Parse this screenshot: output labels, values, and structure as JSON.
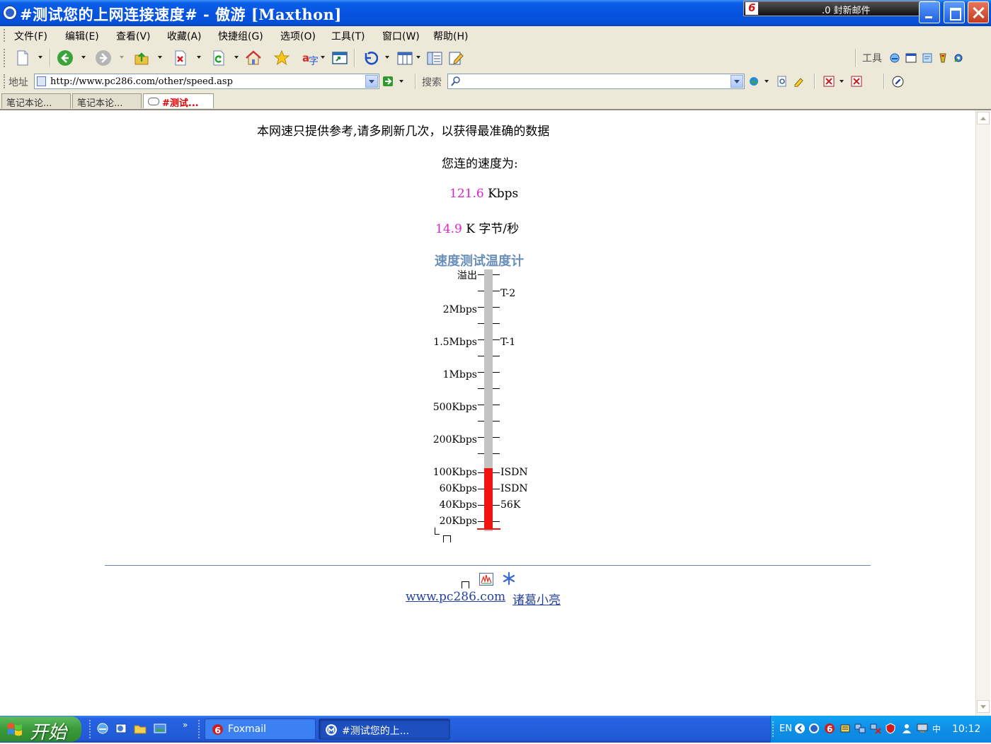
{
  "window": {
    "title": "#测试您的上网连接速度# - 傲游 [Maxthon]",
    "mail_notice": ".0 封新邮件"
  },
  "menu": [
    "文件(F)",
    "编辑(E)",
    "查看(V)",
    "收藏(A)",
    "快捷组(G)",
    "选项(O)",
    "工具(T)",
    "窗口(W)",
    "帮助(H)"
  ],
  "toolbar": {
    "tools_label": "工具"
  },
  "address": {
    "label": "地址",
    "url": "http://www.pc286.com/other/speed.asp",
    "search_label": "搜索",
    "search_value": ""
  },
  "tabs": [
    {
      "label": "笔记本论..."
    },
    {
      "label": "笔记本论..."
    },
    {
      "label": "#测试..."
    }
  ],
  "page": {
    "notice": "本网速只提供参考,请多刷新几次，以获得最准确的数据",
    "speed_label": "您连的速度为:",
    "kbps_value": "121.6",
    "kbps_unit": "Kbps",
    "bytes_value": "14.9",
    "bytes_unit": "K 字节/秒",
    "thermometer_title": "速度测试温度计",
    "scale_left": [
      "溢出",
      "2Mbps",
      "1.5Mbps",
      "1Mbps",
      "500Kbps",
      "200Kbps",
      "100Kbps",
      "60Kbps",
      "40Kbps",
      "20Kbps"
    ],
    "scale_right": [
      "T-2",
      "T-1",
      "ISDN",
      "ISDN",
      "56K"
    ],
    "links": [
      "www.pc286.com",
      "诸葛小亮"
    ]
  },
  "thermometer": {
    "measured_kbps": 121.6
  },
  "taskbar": {
    "start_label": "开始",
    "tasks": [
      "Foxmail",
      "#测试您的上..."
    ],
    "lang": "EN",
    "clock": "10:12"
  }
}
